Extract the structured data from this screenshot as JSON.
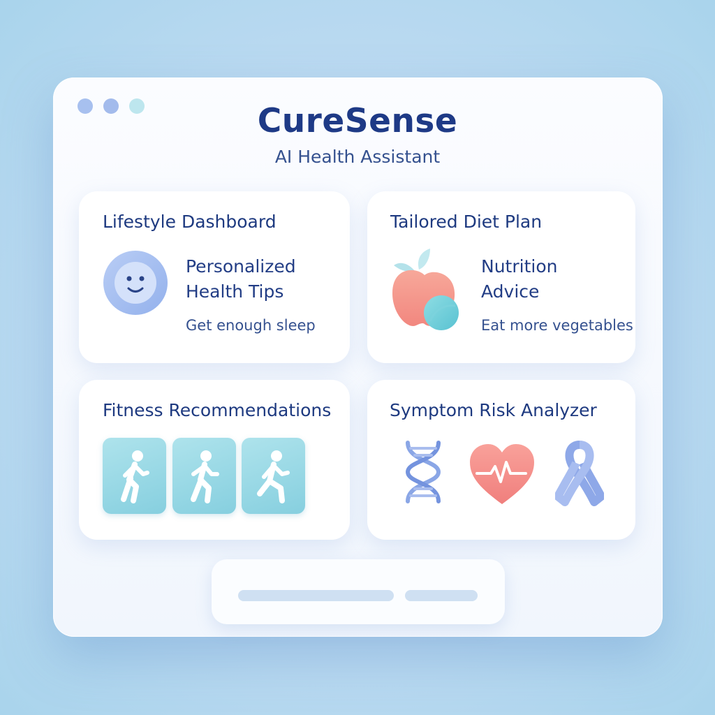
{
  "app": {
    "title": "CureSense",
    "subtitle": "AI Health Assistant"
  },
  "window_controls": [
    "dot",
    "dot",
    "dot"
  ],
  "cards": {
    "lifestyle": {
      "title": "Lifestyle Dashboard",
      "heading_line1": "Personalized",
      "heading_line2": "Health Tips",
      "tip": "Get enough sleep",
      "icon": "smiley-face-icon"
    },
    "diet": {
      "title": "Tailored Diet Plan",
      "heading_line1": "Nutrition",
      "heading_line2": "Advice",
      "tip": "Eat more vegetables",
      "icon": "apple-icon"
    },
    "fitness": {
      "title": "Fitness Recommendations",
      "icons": [
        "walking-person-icon",
        "walking-person-icon",
        "running-person-icon"
      ]
    },
    "symptom": {
      "title": "Symptom Risk Analyzer",
      "icons": [
        "dna-icon",
        "heartbeat-icon",
        "awareness-ribbon-icon"
      ]
    }
  },
  "colors": {
    "title": "#1e3a86",
    "accent_blue": "#a7c0ef",
    "teal": "#86cfdf",
    "coral": "#f48e8e"
  }
}
